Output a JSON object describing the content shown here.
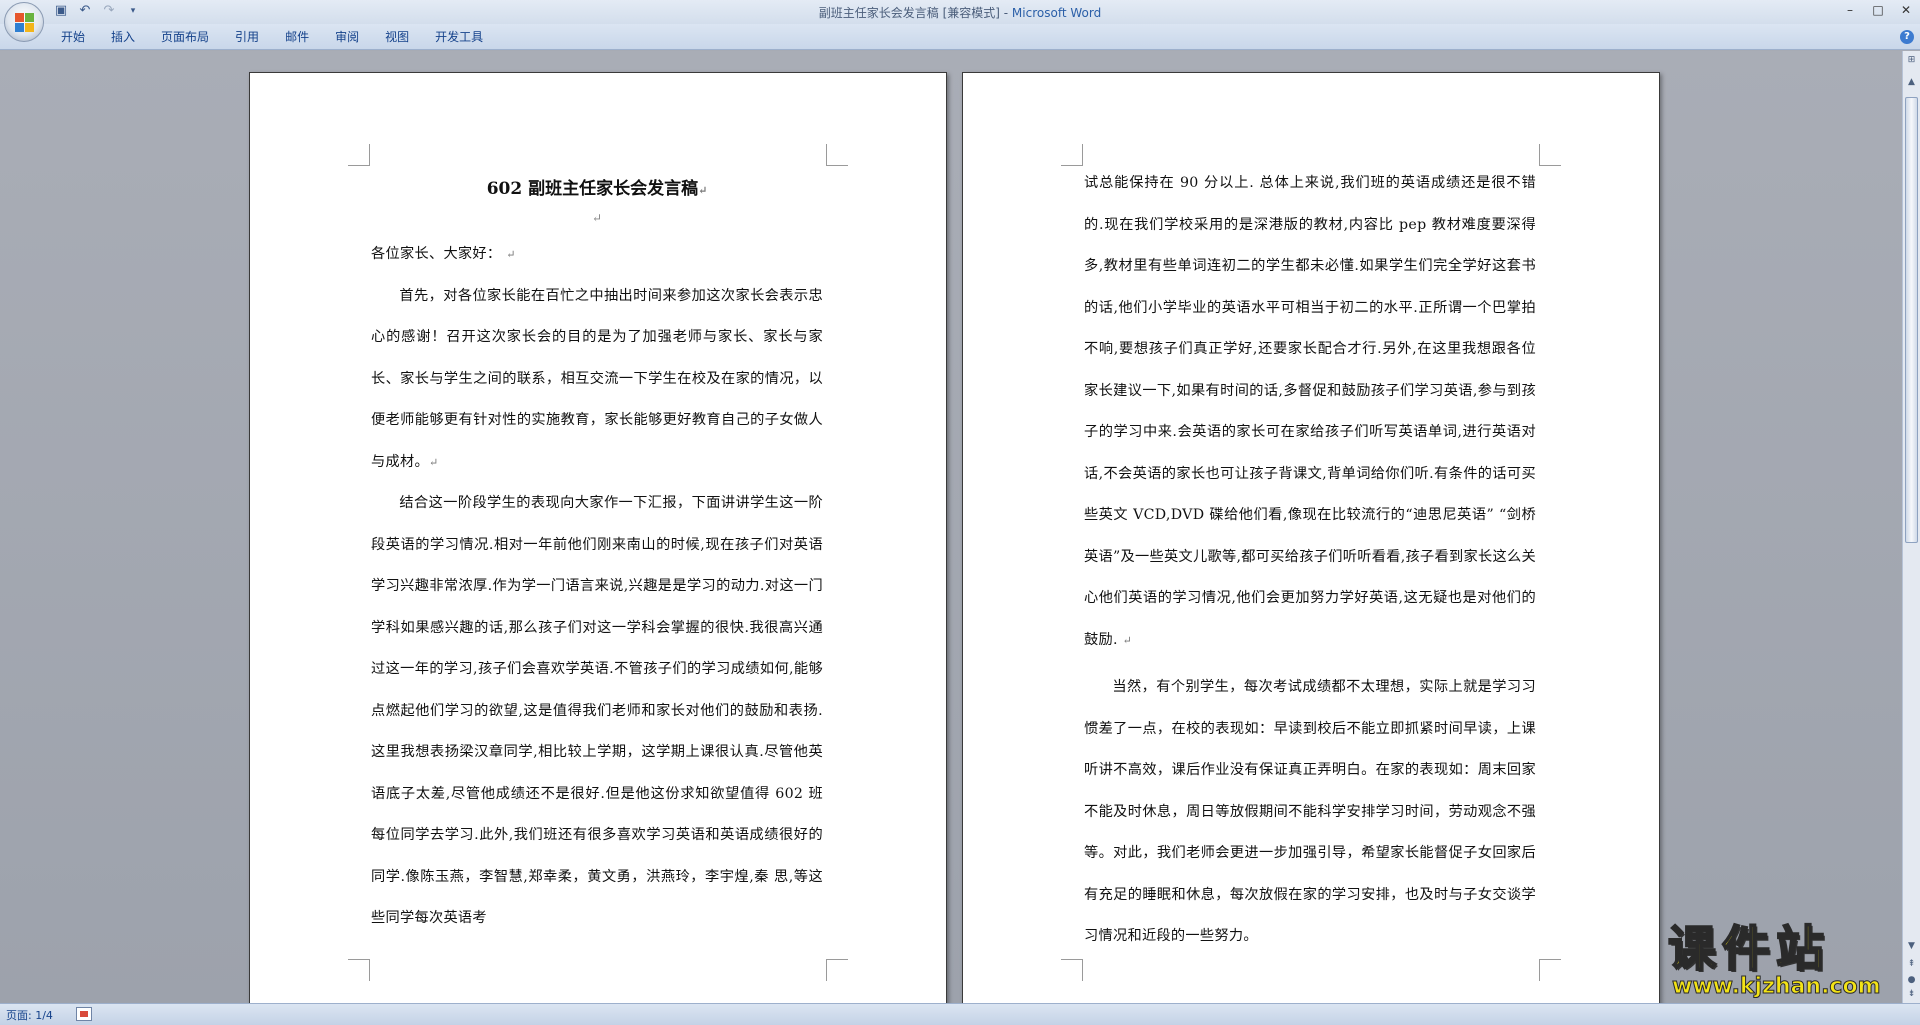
{
  "window": {
    "title": "副班主任家长会发言稿 [兼容模式] - ",
    "app_name": "Microsoft Word",
    "controls": [
      "–",
      "□",
      "✕"
    ]
  },
  "ribbon": {
    "tabs": [
      "开始",
      "插入",
      "页面布局",
      "引用",
      "邮件",
      "审阅",
      "视图",
      "开发工具"
    ],
    "help": "?"
  },
  "document": {
    "page1": {
      "title": "602 副班主任家长会发言稿",
      "paragraphs": [
        {
          "text": "各位家长、大家好：",
          "indent": false
        },
        {
          "text": "首先，对各位家长能在百忙之中抽出时间来参加这次家长会表示忠心的感谢！召开这次家长会的目的是为了加强老师与家长、家长与家长、家长与学生之间的联系，相互交流一下学生在校及在家的情况，以便老师能够更有针对性的实施教育，家长能够更好教育自己的子女做人与成材。",
          "indent": true
        },
        {
          "text": "结合这一阶段学生的表现向大家作一下汇报，下面讲讲学生这一阶段英语的学习情况.相对一年前他们刚来南山的时候,现在孩子们对英语学习兴趣非常浓厚.作为学一门语言来说,兴趣是是学习的动力.对这一门学科如果感兴趣的话,那么孩子们对这一学科会掌握的很快.我很高兴通过这一年的学习,孩子们会喜欢学英语.不管孩子们的学习成绩如何,能够点燃起他们学习的欲望,这是值得我们老师和家长对他们的鼓励和表扬.这里我想表扬梁汉章同学,相比较上学期，这学期上课很认真.尽管他英语底子太差,尽管他成绩还不是很好.但是他这份求知欲望值得 602 班每位同学去学习.此外,我们班还有很多喜欢学习英语和英语成绩很好的同学.像陈玉燕，李智慧,郑幸柔，黄文勇，洪燕玲，李宇煌,秦 思,等这些同学每次英语考",
          "indent": true
        }
      ]
    },
    "page2": {
      "paragraphs": [
        {
          "text": "试总能保持在 90 分以上. 总体上来说,我们班的英语成绩还是很不错的.现在我们学校采用的是深港版的教材,内容比 pep 教材难度要深得多,教材里有些单词连初二的学生都未必懂.如果学生们完全学好这套书的话,他们小学毕业的英语水平可相当于初二的水平.正所谓一个巴掌拍不响,要想孩子们真正学好,还要家长配合才行.另外,在这里我想跟各位家长建议一下,如果有时间的话,多督促和鼓励孩子们学习英语,参与到孩子的学习中来.会英语的家长可在家给孩子们听写英语单词,进行英语对话,不会英语的家长也可让孩子背课文,背单词给你们听.有条件的话可买些英文 VCD,DVD 碟给他们看,像现在比较流行的“迪思尼英语” “剑桥英语”及一些英文儿歌等,都可买给孩子们听听看看,孩子看到家长这么关心他们英语的学习情况,他们会更加努力学好英语,这无疑也是对他们的鼓励.",
          "indent": false
        },
        {
          "text": "当然，有个别学生，每次考试成绩都不太理想，实际上就是学习习惯差了一点，在校的表现如：早读到校后不能立即抓紧时间早读，上课听讲不高效，课后作业没有保证真正弄明白。在家的表现如：周末回家不能及时休息，周日等放假期间不能科学安排学习时间，劳动观念不强等。对此，我们老师会更进一步加强引导，希望家长能督促子女回家后有充足的睡眠和休息，每次放假在家的学习安排，也及时与子女交谈学习情况和近段的一些努力。",
          "indent": true
        }
      ]
    },
    "paragraph_mark": "↵"
  },
  "statusbar": {
    "page_indicator": "页面: 1/4"
  },
  "watermark": {
    "title": "课件站",
    "url": "www.kjzhan.com"
  },
  "colors": {
    "accent": "#15428b",
    "workspace": "#a7abb4",
    "watermark": "#f3e316"
  },
  "icons": [
    "office-button-icon",
    "save-icon",
    "undo-icon",
    "redo-icon",
    "customize-qat-icon",
    "help-icon",
    "scroll-up-icon",
    "scroll-down-icon",
    "browse-object-icon",
    "macro-status-icon"
  ]
}
